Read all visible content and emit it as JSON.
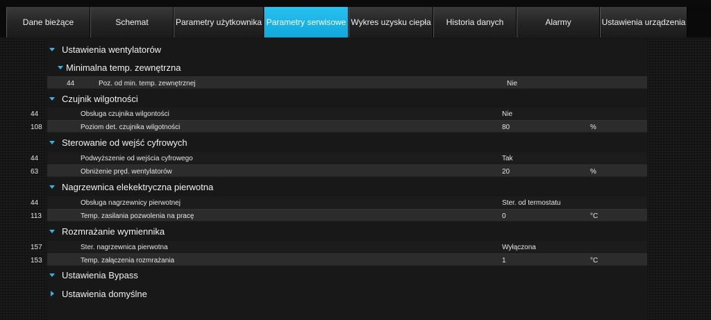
{
  "tabs": [
    {
      "label": "Dane bieżące",
      "active": false
    },
    {
      "label": "Schemat",
      "active": false
    },
    {
      "label": "Parametry użytkownika",
      "active": false
    },
    {
      "label": "Parametry serwisowe",
      "active": true
    },
    {
      "label": "Wykres uzysku ciepła",
      "active": false
    },
    {
      "label": "Historia danych",
      "active": false
    },
    {
      "label": "Alarmy",
      "active": false
    },
    {
      "label": "Ustawienia urządzenia",
      "active": false
    }
  ],
  "sections": {
    "wentylatory": {
      "title": "Ustawienia wentylatorów"
    },
    "min_temp": {
      "title": "Minimalna temp. zewnętrzna",
      "rows": [
        {
          "id": "44",
          "name": "Poz. od min. temp. zewnętrznej",
          "value": "Nie",
          "unit": ""
        }
      ]
    },
    "czujnik": {
      "title": "Czujnik wilgotności",
      "rows": [
        {
          "id": "44",
          "name": "Obsługa czujnika wilgontości",
          "value": "Nie",
          "unit": ""
        },
        {
          "id": "108",
          "name": "Poziom det. czujnika wilgotności",
          "value": "80",
          "unit": "%"
        }
      ]
    },
    "wejscia": {
      "title": "Sterowanie od wejść cyfrowych",
      "rows": [
        {
          "id": "44",
          "name": "Podwyższenie od wejścia cyfrowego",
          "value": "Tak",
          "unit": ""
        },
        {
          "id": "63",
          "name": "Obniżenie pręd. wentylatorów",
          "value": "20",
          "unit": "%"
        }
      ]
    },
    "nagrzewnica": {
      "title": "Nagrzewnica elekektryczna pierwotna",
      "rows": [
        {
          "id": "44",
          "name": "Obsługa nagrzewnicy pierwotnej",
          "value": "Ster. od termostatu",
          "unit": ""
        },
        {
          "id": "113",
          "name": "Temp. zasilania pozwolenia na pracę",
          "value": "0",
          "unit": "°C"
        }
      ]
    },
    "rozmrazanie": {
      "title": "Rozmrażanie wymiennika",
      "rows": [
        {
          "id": "157",
          "name": "Ster. nagrzewnica pierwotna",
          "value": "Wyłączona",
          "unit": ""
        },
        {
          "id": "153",
          "name": "Temp. załączenia rozmrażania",
          "value": "1",
          "unit": "°C"
        }
      ]
    },
    "bypass": {
      "title": "Ustawienia Bypass"
    },
    "domyslne": {
      "title": "Ustawienia domyślne"
    }
  }
}
